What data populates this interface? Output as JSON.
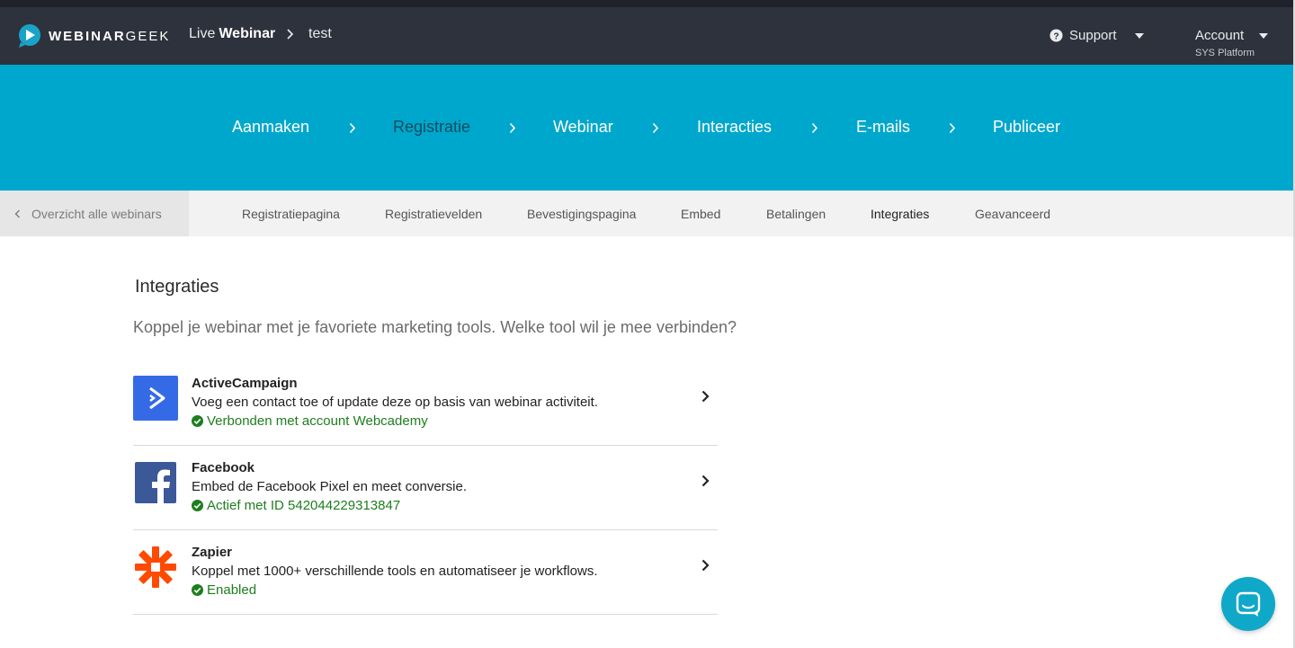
{
  "header": {
    "logo": {
      "text_bold": "WEBINAR",
      "text_thin": "GEEK"
    },
    "breadcrumb": {
      "prefix": "Live",
      "section": "Webinar",
      "current": "test"
    },
    "support_label": "Support",
    "account_label": "Account",
    "account_sub": "SYS Platform"
  },
  "steps": [
    {
      "label": "Aanmaken",
      "active": true
    },
    {
      "label": "Registratie",
      "active": false
    },
    {
      "label": "Webinar",
      "active": true
    },
    {
      "label": "Interacties",
      "active": true
    },
    {
      "label": "E-mails",
      "active": true
    },
    {
      "label": "Publiceer",
      "active": true
    }
  ],
  "subnav": {
    "back_label": "Overzicht alle webinars",
    "tabs": [
      {
        "label": "Registratiepagina"
      },
      {
        "label": "Registratievelden"
      },
      {
        "label": "Bevestigingspagina"
      },
      {
        "label": "Embed"
      },
      {
        "label": "Betalingen"
      },
      {
        "label": "Integraties",
        "active": true
      },
      {
        "label": "Geavanceerd"
      }
    ]
  },
  "main": {
    "title": "Integraties",
    "subtitle": "Koppel je webinar met je favoriete marketing tools. Welke tool wil je mee verbinden?",
    "integrations": [
      {
        "name": "ActiveCampaign",
        "description": "Voeg een contact toe of update deze op basis van webinar activiteit.",
        "status": "Verbonden met account Webcademy",
        "icon": "activecampaign-logo"
      },
      {
        "name": "Facebook",
        "description": "Embed de Facebook Pixel en meet conversie.",
        "status": "Actief met ID 542044229313847",
        "icon": "facebook-logo"
      },
      {
        "name": "Zapier",
        "description": "Koppel met 1000+ verschillende tools en automatiseer je workflows.",
        "status": "Enabled",
        "icon": "zapier-logo"
      }
    ]
  },
  "colors": {
    "header_bg": "#2e323c",
    "steps_bg": "#00a7cc",
    "status_green": "#1e7e1e",
    "chat_bg": "#0fa8c9"
  }
}
